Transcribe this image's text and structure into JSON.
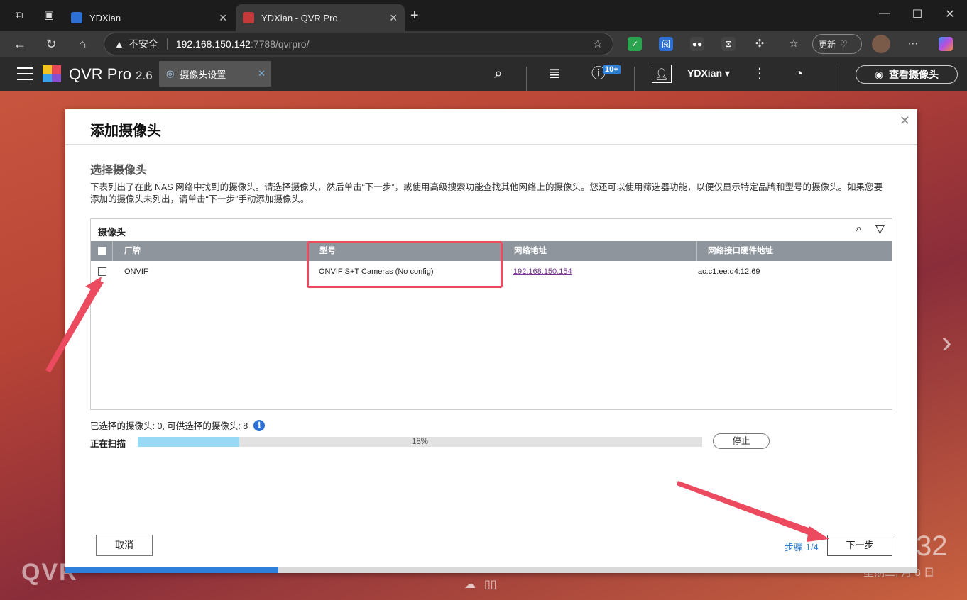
{
  "browser": {
    "tabs": [
      {
        "label": "YDXian",
        "active": false
      },
      {
        "label": "YDXian - QVR Pro",
        "active": true
      }
    ],
    "address": {
      "security_label": "不安全",
      "host": "192.168.150.142",
      "path": ":7788/qvrpro/"
    },
    "update_label": "更新"
  },
  "app": {
    "name": "QVR Pro",
    "version": "2.6",
    "open_tab": "摄像头设置",
    "notification_badge": "10+",
    "user": "YDXian ▾",
    "view_cameras_label": "查看摄像头"
  },
  "dialog": {
    "title": "添加摄像头",
    "section_title": "选择摄像头",
    "description": "下表列出了在此 NAS 网络中找到的摄像头。请选择摄像头，然后单击“下一步”，或使用高级搜索功能查找其他网络上的摄像头。您还可以使用筛选器功能，以便仅显示特定品牌和型号的摄像头。如果您要添加的摄像头未列出，请单击“下一步”手动添加摄像头。",
    "grid_title": "摄像头",
    "columns": [
      "厂牌",
      "型号",
      "网络地址",
      "网络接口硬件地址"
    ],
    "rows": [
      {
        "brand": "ONVIF",
        "model": "ONVIF S+T Cameras (No config)",
        "ip": "192.168.150.154",
        "mac": "ac:c1:ee:d4:12:69",
        "checked": false
      }
    ],
    "selection_info": "已选择的摄像头:  0, 可供选择的摄像头:  8",
    "scanning_label": "正在扫描",
    "progress_percent": 18,
    "progress_text": "18%",
    "stop_label": "停止",
    "cancel_label": "取消",
    "step_label": "步骤 1/4",
    "next_label": "下一步"
  },
  "desktop": {
    "watermark": "QVR",
    "clock": "32",
    "date": "星期二, 月 8 日"
  },
  "colors": {
    "accent": "#2d7fd7",
    "annotation": "#ec4a5f",
    "progress_fill": "#98d9f5",
    "grid_header": "#8e959d"
  }
}
